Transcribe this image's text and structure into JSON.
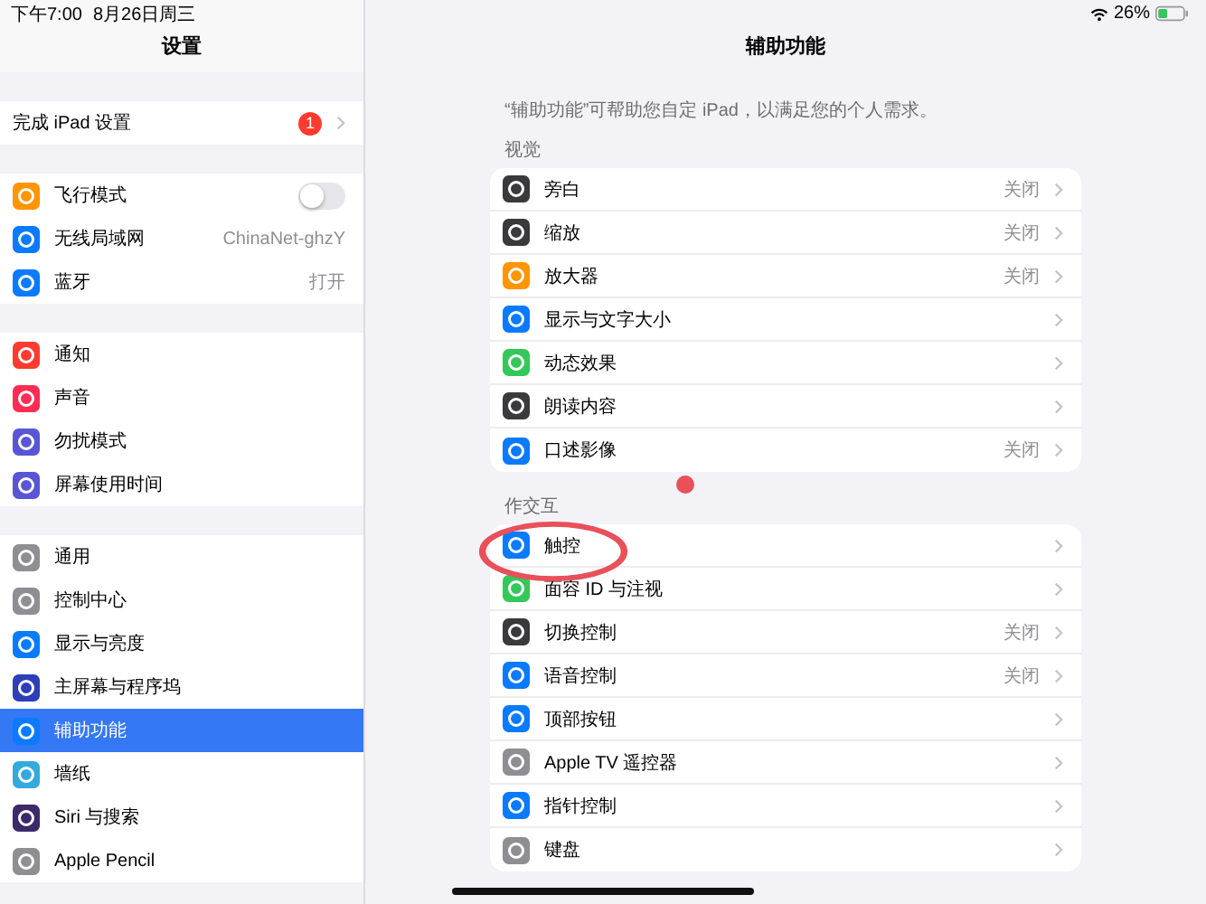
{
  "status_bar": {
    "time": "下午7:00",
    "date": "8月26日周三",
    "battery": "26%"
  },
  "sidebar": {
    "title": "设置",
    "groups": [
      [
        {
          "label": "完成 iPad 设置",
          "badge": "1",
          "selected": false
        }
      ],
      [
        {
          "label": "飞行模式",
          "color": "#ff9500",
          "toggle": {
            "on": false
          },
          "selected": false
        },
        {
          "label": "无线局域网",
          "color": "#0a7aff",
          "value": "ChinaNet-ghzY",
          "selected": false
        },
        {
          "label": "蓝牙",
          "color": "#0a7aff",
          "value": "打开",
          "selected": false
        }
      ],
      [
        {
          "label": "通知",
          "color": "#ff3b30",
          "selected": false
        },
        {
          "label": "声音",
          "color": "#ff2d55",
          "selected": false
        },
        {
          "label": "勿扰模式",
          "color": "#5856d6",
          "selected": false
        },
        {
          "label": "屏幕使用时间",
          "color": "#5856d6",
          "selected": false
        }
      ],
      [
        {
          "label": "通用",
          "color": "#8e8e93",
          "selected": false
        },
        {
          "label": "控制中心",
          "color": "#8e8e93",
          "selected": false
        },
        {
          "label": "显示与亮度",
          "color": "#0a7aff",
          "selected": false
        },
        {
          "label": "主屏幕与程序坞",
          "color": "#2c3fb8",
          "selected": false
        },
        {
          "label": "辅助功能",
          "color": "#0a7aff",
          "selected": true
        },
        {
          "label": "墙纸",
          "color": "#34aadc",
          "selected": false
        },
        {
          "label": "Siri 与搜索",
          "color": "#3a2a6a",
          "selected": false
        },
        {
          "label": "Apple Pencil",
          "color": "#8e8e93",
          "selected": false
        }
      ]
    ]
  },
  "main": {
    "title": "辅助功能",
    "description": "“辅助功能”可帮助您自定 iPad，以满足您的个人需求。",
    "sections": [
      {
        "header": "视觉",
        "rows": [
          {
            "label": "旁白",
            "color": "#3a3a3c",
            "value": "关闭"
          },
          {
            "label": "缩放",
            "color": "#3a3a3c",
            "value": "关闭"
          },
          {
            "label": "放大器",
            "color": "#ff9500",
            "value": "关闭"
          },
          {
            "label": "显示与文字大小",
            "color": "#0a7aff"
          },
          {
            "label": "动态效果",
            "color": "#34c759"
          },
          {
            "label": "朗读内容",
            "color": "#3a3a3c"
          },
          {
            "label": "口述影像",
            "color": "#0a7aff",
            "value": "关闭"
          }
        ]
      },
      {
        "header": "作交互",
        "rows": [
          {
            "label": "触控",
            "color": "#0a7aff"
          },
          {
            "label": "面容 ID 与注视",
            "color": "#34c759"
          },
          {
            "label": "切换控制",
            "color": "#3a3a3c",
            "value": "关闭"
          },
          {
            "label": "语音控制",
            "color": "#0a7aff",
            "value": "关闭"
          },
          {
            "label": "顶部按钮",
            "color": "#0a7aff"
          },
          {
            "label": "Apple TV 遥控器",
            "color": "#8e8e93"
          },
          {
            "label": "指针控制",
            "color": "#0a7aff"
          },
          {
            "label": "键盘",
            "color": "#8e8e93"
          }
        ]
      }
    ]
  }
}
